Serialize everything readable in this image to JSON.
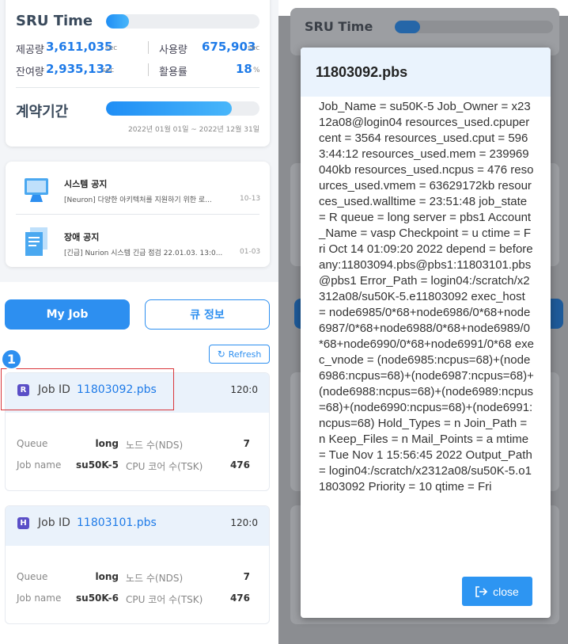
{
  "sru": {
    "title": "SRU Time",
    "usage_fraction": 0.15,
    "provided_label": "제공량",
    "provided_value": "3,611,035",
    "provided_unit": "sec",
    "used_label": "사용량",
    "used_value": "675,903",
    "used_unit": "sec",
    "remain_label": "잔여량",
    "remain_value": "2,935,132",
    "remain_unit": "sec",
    "rate_label": "활용률",
    "rate_value": "18",
    "rate_unit": "%"
  },
  "contract": {
    "title": "계약기간",
    "progress_fraction": 0.82,
    "range": "2022년 01월 01일 ~ 2022년 12월 31일"
  },
  "notices": [
    {
      "title": "시스템 공지",
      "text": "[Neuron] 다양한 아키텍처를 지원하기 위한 로...",
      "date": "10-13",
      "icon": "monitor-icon"
    },
    {
      "title": "장애 공지",
      "text": "[긴급] Nurion 시스템 긴급 점검 22.01.03. 13:0...",
      "date": "01-03",
      "icon": "document-icon"
    }
  ],
  "tabs": {
    "my_job": "My Job",
    "queue_info": "큐 정보"
  },
  "refresh_label": "Refresh",
  "marker": "1",
  "jobs": [
    {
      "badge": "R",
      "id_label": "Job ID",
      "id": "11803092.pbs",
      "time": "120:0",
      "queue_label": "Queue",
      "queue": "long",
      "nodes_label": "노드 수(NDS)",
      "nodes": "7",
      "name_label": "Job name",
      "name": "su50K-5",
      "cores_label": "CPU 코어 수(TSK)",
      "cores": "476"
    },
    {
      "badge": "H",
      "id_label": "Job ID",
      "id": "11803101.pbs",
      "time": "120:0",
      "queue_label": "Queue",
      "queue": "long",
      "nodes_label": "노드 수(NDS)",
      "nodes": "7",
      "name_label": "Job name",
      "name": "su50K-6",
      "cores_label": "CPU 코어 수(TSK)",
      "cores": "476"
    }
  ],
  "background": {
    "sru_title": "SRU Time"
  },
  "modal": {
    "title": "11803092.pbs",
    "body": "Job_Name = su50K-5 Job_Owner = x2312a08@login04 resources_used.cpupercent = 3564 resources_used.cput = 5963:44:12 resources_used.mem = 239969040kb resources_used.ncpus = 476 resources_used.vmem = 63629172kb resources_used.walltime = 23:51:48 job_state = R queue = long server = pbs1 Account_Name = vasp Checkpoint = u ctime = Fri Oct 14 01:09:20 2022 depend = beforeany:11803094.pbs@pbs1:11803101.pbs@pbs1 Error_Path = login04:/scratch/x2312a08/su50K-5.e11803092 exec_host = node6985/0*68+node6986/0*68+node6987/0*68+node6988/0*68+node6989/0*68+node6990/0*68+node6991/0*68 exec_vnode = (node6985:ncpus=68)+(node6986:ncpus=68)+(node6987:ncpus=68)+(node6988:ncpus=68)+(node6989:ncpus=68)+(node6990:ncpus=68)+(node6991:ncpus=68) Hold_Types = n Join_Path = n Keep_Files = n Mail_Points = a mtime = Tue Nov 1 15:56:45 2022 Output_Path = login04:/scratch/x2312a08/su50K-5.o11803092 Priority = 10 qtime = Fri",
    "close_label": "close"
  }
}
